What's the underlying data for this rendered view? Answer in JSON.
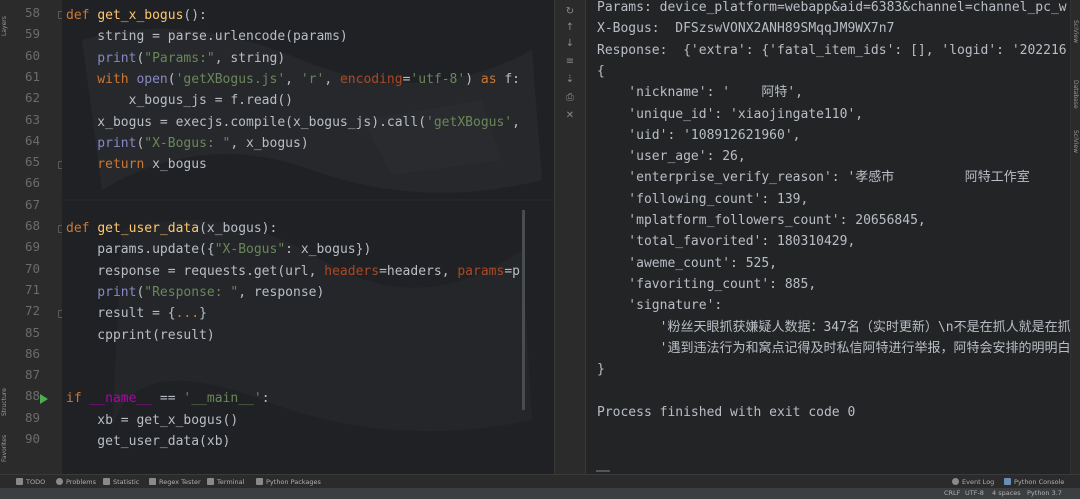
{
  "left_strip": {
    "top_label": "Layers",
    "structure_label": "Structure",
    "favorites_label": "Favorites"
  },
  "right_strip": {
    "labels": [
      "SciView",
      "Database",
      "SciView"
    ]
  },
  "gutter": {
    "line_numbers": [
      "58",
      "59",
      "60",
      "61",
      "62",
      "63",
      "64",
      "65",
      "66",
      "67",
      "68",
      "69",
      "70",
      "71",
      "72",
      "85",
      "86",
      "87",
      "88",
      "89",
      "90"
    ]
  },
  "editor": {
    "lines": [
      {
        "n": "58",
        "segs": [
          [
            "kw",
            "def "
          ],
          [
            "fn",
            "get_x_bogus"
          ],
          [
            "",
            "():"
          ]
        ]
      },
      {
        "n": "59",
        "segs": [
          [
            "",
            "    string = parse.urlencode(params)"
          ]
        ]
      },
      {
        "n": "60",
        "segs": [
          [
            "bi",
            "    print"
          ],
          [
            "",
            "("
          ],
          [
            "str",
            "\"Params:\""
          ],
          [
            "",
            ", string)"
          ]
        ]
      },
      {
        "n": "61",
        "segs": [
          [
            "kw",
            "    with "
          ],
          [
            "bi",
            "open"
          ],
          [
            "",
            "("
          ],
          [
            "str",
            "'getXBogus.js'"
          ],
          [
            "",
            ", "
          ],
          [
            "str",
            "'r'"
          ],
          [
            "",
            ", "
          ],
          [
            "par",
            "encoding"
          ],
          [
            "",
            "="
          ],
          [
            "str",
            "'utf-8'"
          ],
          [
            "",
            ") "
          ],
          [
            "kw",
            "as"
          ],
          [
            "",
            " f:"
          ]
        ]
      },
      {
        "n": "62",
        "segs": [
          [
            "",
            "        x_bogus_js = f.read()"
          ]
        ]
      },
      {
        "n": "63",
        "segs": [
          [
            "",
            "    x_bogus = execjs.compile(x_bogus_js).call("
          ],
          [
            "str",
            "'getXBogus'"
          ],
          [
            "",
            ","
          ]
        ]
      },
      {
        "n": "64",
        "segs": [
          [
            "bi",
            "    print"
          ],
          [
            "",
            "("
          ],
          [
            "str",
            "\"X-Bogus: \""
          ],
          [
            "",
            ", x_bogus)"
          ]
        ]
      },
      {
        "n": "65",
        "segs": [
          [
            "kw",
            "    return "
          ],
          [
            "",
            "x_bogus"
          ]
        ]
      },
      {
        "n": "66",
        "segs": [
          [
            "",
            ""
          ]
        ]
      },
      {
        "n": "67",
        "segs": [
          [
            "",
            ""
          ]
        ]
      },
      {
        "n": "68",
        "segs": [
          [
            "kw",
            "def "
          ],
          [
            "fn",
            "get_user_data"
          ],
          [
            "",
            "(x_bogus):"
          ]
        ]
      },
      {
        "n": "69",
        "segs": [
          [
            "",
            "    params.update({"
          ],
          [
            "str",
            "\"X-Bogus\""
          ],
          [
            "",
            ": x_bogus})"
          ]
        ]
      },
      {
        "n": "70",
        "segs": [
          [
            "",
            "    response = requests.get(url, "
          ],
          [
            "par",
            "headers"
          ],
          [
            "",
            "=headers, "
          ],
          [
            "par",
            "params"
          ],
          [
            "",
            "=p"
          ]
        ]
      },
      {
        "n": "71",
        "segs": [
          [
            "bi",
            "    print"
          ],
          [
            "",
            "("
          ],
          [
            "str",
            "\"Response: \""
          ],
          [
            "",
            ", response)"
          ]
        ]
      },
      {
        "n": "72",
        "segs": [
          [
            "",
            "    result = {"
          ],
          [
            "kw",
            "..."
          ],
          [
            "",
            "}"
          ]
        ]
      },
      {
        "n": "85",
        "segs": [
          [
            "",
            "    cpprint(result)"
          ]
        ]
      },
      {
        "n": "86",
        "segs": [
          [
            "",
            ""
          ]
        ]
      },
      {
        "n": "87",
        "segs": [
          [
            "",
            ""
          ]
        ]
      },
      {
        "n": "88",
        "segs": [
          [
            "kw",
            "if "
          ],
          [
            "dn",
            "__name__"
          ],
          [
            "",
            " == "
          ],
          [
            "str",
            "'__main__'"
          ],
          [
            "",
            ":"
          ]
        ]
      },
      {
        "n": "89",
        "segs": [
          [
            "",
            "    xb = get_x_bogus()"
          ]
        ]
      },
      {
        "n": "90",
        "segs": [
          [
            "",
            "    get_user_data(xb)"
          ]
        ]
      }
    ]
  },
  "console": {
    "lines": [
      "Params: device_platform=webapp&aid=6383&channel=channel_pc_w",
      "X-Bogus:  DFSzswVONX2ANH89SMqqJM9WX7n7",
      "Response:  {'extra': {'fatal_item_ids': [], 'logid': '202216",
      "{",
      "    'nickname': '    阿特',",
      "    'unique_id': 'xiaojingate110',",
      "    'uid': '108912621960',",
      "    'user_age': 26,",
      "    'enterprise_verify_reason': '孝感市         阿特工作室",
      "    'following_count': 139,",
      "    'mplatform_followers_count': 20656845,",
      "    'total_favorited': 180310429,",
      "    'aweme_count': 525,",
      "    'favoriting_count': 885,",
      "    'signature':",
      "        '粉丝天眼抓获嫌疑人数据：347名（实时更新）\\n不是在抓人就是在抓",
      "        '遇到违法行为和窝点记得及时私信阿特进行举报，阿特会安排的明明白",
      "}",
      "",
      "Process finished with exit code 0"
    ]
  },
  "bottom_tabs": [
    "TODO",
    "Problems",
    "Statistic",
    "Regex Tester",
    "Terminal",
    "Python Packages"
  ],
  "bottom_right_tabs": [
    "Event Log",
    "Python Console"
  ],
  "status": {
    "crlf": "CRLF",
    "encoding": "UTF-8",
    "indent": "4 spaces",
    "interpreter": "Python 3.7"
  },
  "colors": {
    "keyword": "#cc7832",
    "function": "#ffc66d",
    "string": "#6a8759",
    "builtin": "#8888c6",
    "param": "#aa4926",
    "dunder": "#b200b2",
    "text": "#b9bec6"
  }
}
